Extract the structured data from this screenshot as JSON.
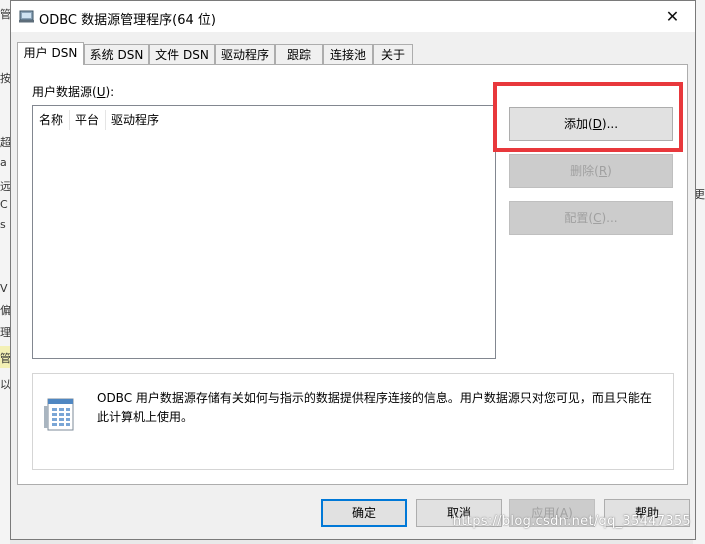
{
  "window": {
    "title": "ODBC 数据源管理程序(64 位)",
    "close_glyph": "✕"
  },
  "background_fragments": {
    "left": [
      "管",
      "按",
      "超",
      "a",
      "远",
      "C",
      "s",
      "V",
      "偏",
      "理",
      "管",
      "以"
    ],
    "right": [
      "更"
    ]
  },
  "tabs": [
    {
      "label": "用户 DSN",
      "active": true
    },
    {
      "label": "系统 DSN",
      "active": false
    },
    {
      "label": "文件 DSN",
      "active": false
    },
    {
      "label": "驱动程序",
      "active": false
    },
    {
      "label": "跟踪",
      "active": false
    },
    {
      "label": "连接池",
      "active": false
    },
    {
      "label": "关于",
      "active": false
    }
  ],
  "user_dsn": {
    "group_label": "用户数据源",
    "group_label_key": "U",
    "columns": [
      "名称",
      "平台",
      "驱动程序"
    ],
    "rows": [],
    "buttons": {
      "add": {
        "label": "添加",
        "key": "D",
        "suffix": "...",
        "enabled": true
      },
      "remove": {
        "label": "删除",
        "key": "R",
        "suffix": "",
        "enabled": false
      },
      "configure": {
        "label": "配置",
        "key": "C",
        "suffix": "...",
        "enabled": false
      }
    },
    "info_text": "ODBC 用户数据源存储有关如何与指示的数据提供程序连接的信息。用户数据源只对您可见，而且只能在此计算机上使用。"
  },
  "footer_buttons": {
    "ok": {
      "label": "确定"
    },
    "cancel": {
      "label": "取消"
    },
    "apply": {
      "label": "应用",
      "key": "A"
    },
    "help": {
      "label": "帮助"
    }
  },
  "watermark": "https://blog.csdn.net/qq_35447355",
  "colors": {
    "highlight": "#e8383c",
    "default_button_border": "#0078d7"
  }
}
